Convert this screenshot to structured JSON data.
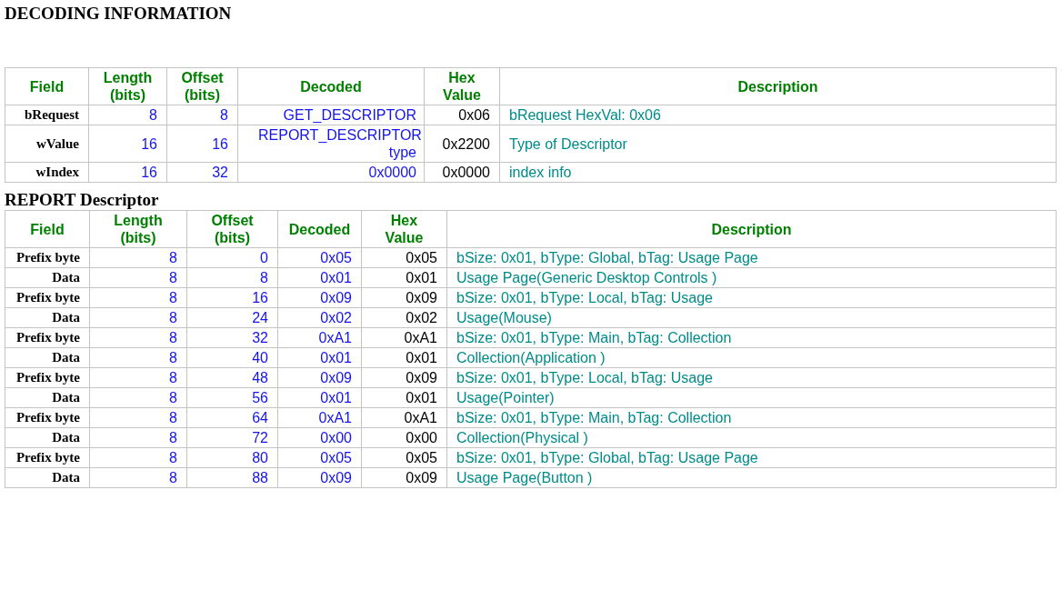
{
  "sections": [
    {
      "title": "DECODING INFORMATION",
      "columns": [
        "Field",
        "Length (bits)",
        "Offset (bits)",
        "Decoded",
        "Hex Value",
        "Description"
      ],
      "rows": [
        [
          "bRequest",
          "8",
          "8",
          "GET_DESCRIPTOR",
          "0x06",
          "bRequest HexVal: 0x06"
        ],
        [
          "wValue",
          "16",
          "16",
          "REPORT_DESCRIPTOR type",
          "0x2200",
          "Type of Descriptor"
        ],
        [
          "wIndex",
          "16",
          "32",
          "0x0000",
          "0x0000",
          "index info"
        ]
      ]
    },
    {
      "title": "REPORT Descriptor",
      "columns": [
        "Field",
        "Length (bits)",
        "Offset (bits)",
        "Decoded",
        "Hex Value",
        "Description"
      ],
      "rows": [
        [
          "Prefix byte",
          "8",
          "0",
          "0x05",
          "0x05",
          "bSize: 0x01, bType: Global, bTag: Usage Page"
        ],
        [
          "Data",
          "8",
          "8",
          "0x01",
          "0x01",
          "Usage Page(Generic Desktop Controls )"
        ],
        [
          "Prefix byte",
          "8",
          "16",
          "0x09",
          "0x09",
          "bSize: 0x01, bType: Local, bTag: Usage"
        ],
        [
          "Data",
          "8",
          "24",
          "0x02",
          "0x02",
          "Usage(Mouse)"
        ],
        [
          "Prefix byte",
          "8",
          "32",
          "0xA1",
          "0xA1",
          "bSize: 0x01, bType: Main, bTag: Collection"
        ],
        [
          "Data",
          "8",
          "40",
          "0x01",
          "0x01",
          "Collection(Application )"
        ],
        [
          "Prefix byte",
          "8",
          "48",
          "0x09",
          "0x09",
          "bSize: 0x01, bType: Local, bTag: Usage"
        ],
        [
          "Data",
          "8",
          "56",
          "0x01",
          "0x01",
          "Usage(Pointer)"
        ],
        [
          "Prefix byte",
          "8",
          "64",
          "0xA1",
          "0xA1",
          "bSize: 0x01, bType: Main, bTag: Collection"
        ],
        [
          "Data",
          "8",
          "72",
          "0x00",
          "0x00",
          "Collection(Physical )"
        ],
        [
          "Prefix byte",
          "8",
          "80",
          "0x05",
          "0x05",
          "bSize: 0x01, bType: Global, bTag: Usage Page"
        ],
        [
          "Data",
          "8",
          "88",
          "0x09",
          "0x09",
          "Usage Page(Button )"
        ]
      ]
    }
  ]
}
